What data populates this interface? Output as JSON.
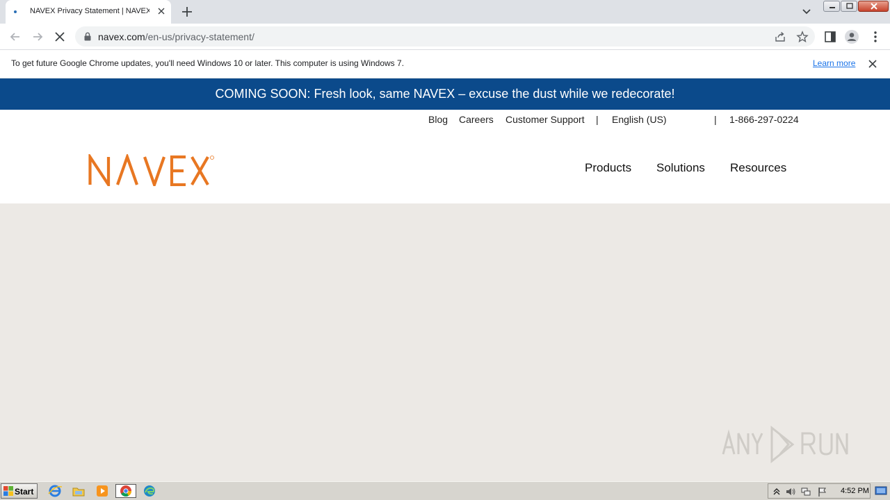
{
  "browser": {
    "tab_title": "NAVEX Privacy Statement | NAVEX",
    "url_host": "navex.com",
    "url_path": "/en-us/privacy-statement/"
  },
  "infobar": {
    "message": "To get future Google Chrome updates, you'll need Windows 10 or later. This computer is using Windows 7.",
    "learn_more": "Learn more"
  },
  "page": {
    "banner": "COMING SOON: Fresh look, same NAVEX – excuse the dust while we redecorate!",
    "utility_nav": {
      "blog": "Blog",
      "careers": "Careers",
      "support": "Customer Support",
      "language": "English (US)",
      "phone": "1-866-297-0224"
    },
    "logo_text": "NAVEX",
    "main_nav": {
      "products": "Products",
      "solutions": "Solutions",
      "resources": "Resources"
    },
    "watermark": "ANY RUN"
  },
  "taskbar": {
    "start_label": "Start",
    "clock": "4:52 PM"
  },
  "colors": {
    "banner_bg": "#0b4a8b",
    "logo_orange": "#e87722",
    "content_bg": "#ece9e5"
  }
}
